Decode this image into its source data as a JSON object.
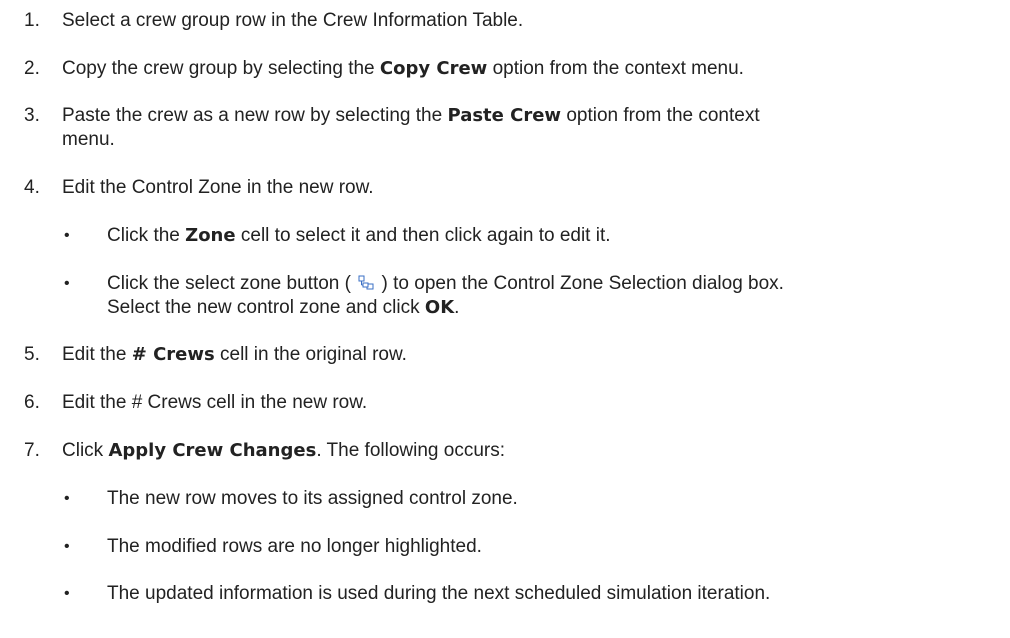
{
  "steps": [
    {
      "num": "1.",
      "text": "Select a crew group row in the Crew Information Table."
    },
    {
      "num": "2.",
      "pre": "Copy the crew group by selecting the ",
      "bold": "Copy Crew",
      "post": " option from the context menu."
    },
    {
      "num": "3.",
      "pre": "Paste the crew as a new row by selecting the ",
      "bold": "Paste Crew",
      "post": " option from the context",
      "line2": "menu."
    },
    {
      "num": "4.",
      "text": "Edit the Control Zone in the new row."
    },
    {
      "num": "5.",
      "pre": "Edit the ",
      "bold": "# Crews",
      "post": " cell in the original row."
    },
    {
      "num": "6.",
      "text": "Edit the # Crews cell in the new row."
    },
    {
      "num": "7.",
      "pre": "Click ",
      "bold": "Apply Crew Changes",
      "post": ". The following occurs:"
    }
  ],
  "step4_bullets": [
    {
      "pre": "Click the ",
      "bold": "Zone",
      "post": " cell to select it and then click again  to edit it."
    },
    {
      "pre": "Click the select zone button ( ",
      "icon": "select-zone-icon",
      "post": " ) to open the Control Zone Selection dialog box.",
      "line2_pre": "Select the new control zone and click ",
      "line2_bold": "OK",
      "line2_post": "."
    }
  ],
  "step7_bullets": [
    {
      "text": "The new row moves to its assigned control zone."
    },
    {
      "text": "The modified rows are no longer highlighted."
    },
    {
      "text": "The updated information is used during the next scheduled simulation iteration."
    }
  ],
  "bullet_char": "•",
  "icon_color": "#3a6fc4"
}
